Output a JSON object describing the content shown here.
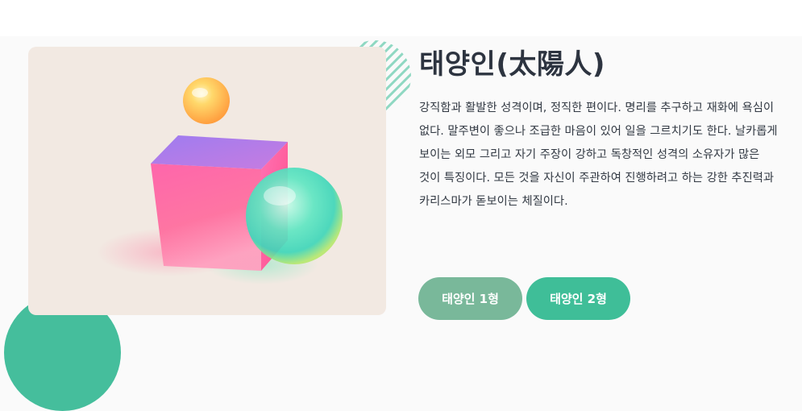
{
  "page": {
    "title": "태양인(太陽人)",
    "description": "강직함과 활발한 성격이며, 정직한 편이다. 명리를 추구하고 재화에 욕심이 없다. 말주변이 좋으나 조급한 마음이 있어 일을 그르치기도 한다. 날카롭게 보이는 외모 그리고 자기 주장이 강하고 독창적인 성격의 소유자가 많은 것이 특징이다. 모든 것을 자신이 주관하여 진행하려고 하는 강한 추진력과 카리스마가 돋보이는 체질이다."
  },
  "buttons": {
    "type1_label": "태양인 1형",
    "type2_label": "태양인 2형"
  },
  "colors": {
    "accent_green": "#3fbe98",
    "muted_green": "#79b89a",
    "title_text": "#2d3440",
    "card_background": "#f2e9e2"
  }
}
